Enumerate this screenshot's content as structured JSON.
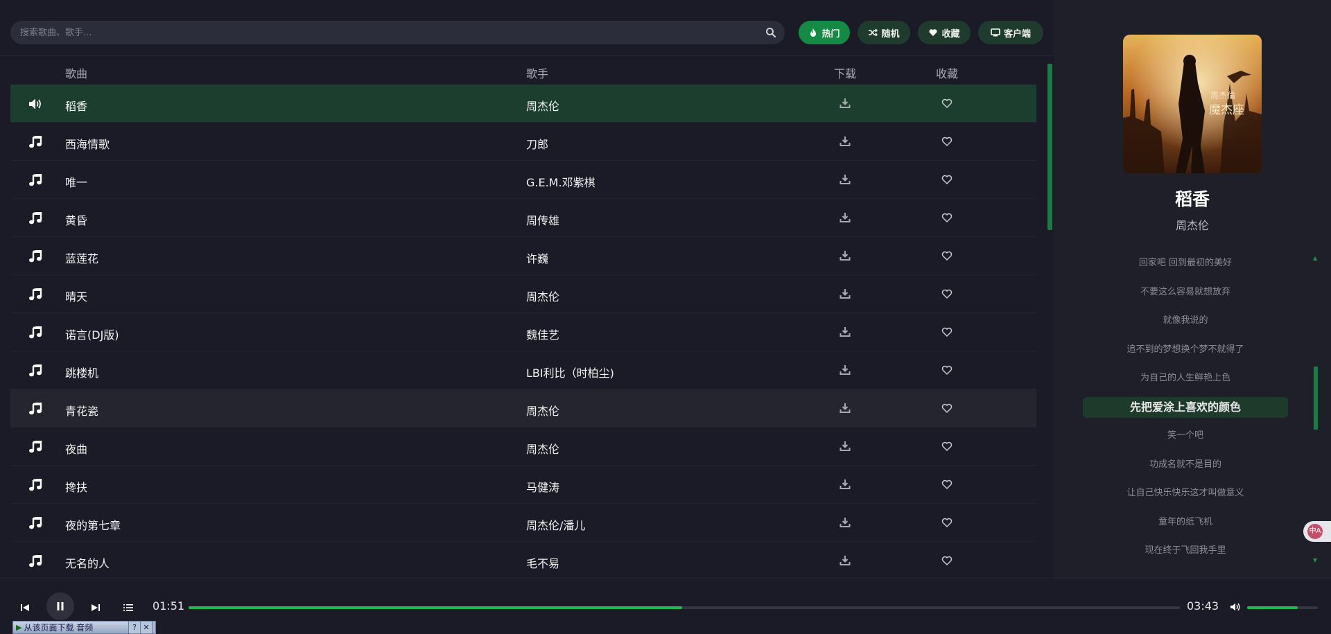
{
  "search": {
    "placeholder": "搜索歌曲、歌手..."
  },
  "tabs": [
    {
      "label": "热门",
      "icon": "fire-icon",
      "active": true
    },
    {
      "label": "随机",
      "icon": "shuffle-icon",
      "active": false
    },
    {
      "label": "收藏",
      "icon": "heart-icon",
      "active": false
    },
    {
      "label": "客户端",
      "icon": "desktop-icon",
      "active": false
    }
  ],
  "table": {
    "headers": {
      "song": "歌曲",
      "artist": "歌手",
      "download": "下载",
      "favorite": "收藏"
    },
    "rows": [
      {
        "title": "稻香",
        "artist": "周杰伦",
        "state": "playing"
      },
      {
        "title": "西海情歌",
        "artist": "刀郎",
        "state": ""
      },
      {
        "title": "唯一",
        "artist": "G.E.M.邓紫棋",
        "state": ""
      },
      {
        "title": "黄昏",
        "artist": "周传雄",
        "state": ""
      },
      {
        "title": "蓝莲花",
        "artist": "许巍",
        "state": ""
      },
      {
        "title": "晴天",
        "artist": "周杰伦",
        "state": ""
      },
      {
        "title": "诺言(DJ版)",
        "artist": "魏佳艺",
        "state": ""
      },
      {
        "title": "跳楼机",
        "artist": "LBI利比（时柏尘)",
        "state": ""
      },
      {
        "title": "青花瓷",
        "artist": "周杰伦",
        "state": "hover"
      },
      {
        "title": "夜曲",
        "artist": "周杰伦",
        "state": ""
      },
      {
        "title": "搀扶",
        "artist": "马健涛",
        "state": ""
      },
      {
        "title": "夜的第七章",
        "artist": "周杰伦/潘儿",
        "state": ""
      },
      {
        "title": "无名的人",
        "artist": "毛不易",
        "state": ""
      }
    ]
  },
  "now_playing": {
    "title": "稻香",
    "artist": "周杰伦",
    "lyrics": [
      "回家吧 回到最初的美好",
      "不要这么容易就想放弃",
      "就像我说的",
      "追不到的梦想换个梦不就得了",
      "为自己的人生鲜艳上色",
      "先把爱涂上喜欢的颜色",
      "笑一个吧",
      "功成名就不是目的",
      "让自己快乐快乐这才叫做意义",
      "童年的纸飞机",
      "现在终于飞回我手里"
    ],
    "active_lyric_index": 5
  },
  "player": {
    "current_time": "01:51",
    "total_time": "03:43",
    "progress": 0.498,
    "volume": 0.72
  },
  "download_bar": {
    "label": "从该页面下载 音频",
    "help": "?",
    "close": "✕"
  },
  "translate": {
    "label": "中A"
  },
  "colors": {
    "accent": "#1db954",
    "playing_row": "#1b3e2f",
    "background": "#1a1b26"
  }
}
